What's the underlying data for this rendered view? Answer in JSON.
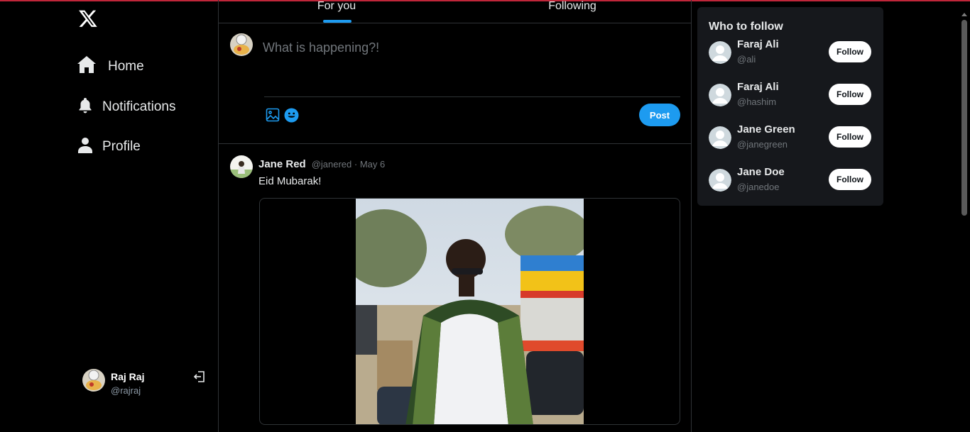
{
  "sidebar": {
    "logo": "x-logo-icon",
    "nav": [
      {
        "label": "Home",
        "icon": "home-icon"
      },
      {
        "label": "Notifications",
        "icon": "bell-icon"
      },
      {
        "label": "Profile",
        "icon": "user-icon"
      }
    ],
    "user": {
      "name": "Raj Raj",
      "handle": "@rajraj"
    }
  },
  "feed": {
    "tabs": [
      {
        "label": "For you",
        "active": true
      },
      {
        "label": "Following",
        "active": false
      }
    ],
    "composer": {
      "placeholder": "What is happening?!",
      "post_label": "Post"
    },
    "tweet": {
      "name": "Jane Red",
      "handle": "@janered",
      "date": "May 6",
      "meta": "@janered · May 6",
      "text": "Eid Mubarak!"
    }
  },
  "who_to_follow": {
    "title": "Who to follow",
    "users": [
      {
        "name": "Faraj Ali",
        "handle": "@ali",
        "button": "Follow"
      },
      {
        "name": "Faraj Ali",
        "handle": "@hashim",
        "button": "Follow"
      },
      {
        "name": "Jane Green",
        "handle": "@janegreen",
        "button": "Follow"
      },
      {
        "name": "Jane Doe",
        "handle": "@janedoe",
        "button": "Follow"
      }
    ]
  },
  "colors": {
    "background": "#000000",
    "accent": "#1d9bf0",
    "border": "#2f3336",
    "card": "#16181c",
    "muted_text": "#71767b"
  }
}
